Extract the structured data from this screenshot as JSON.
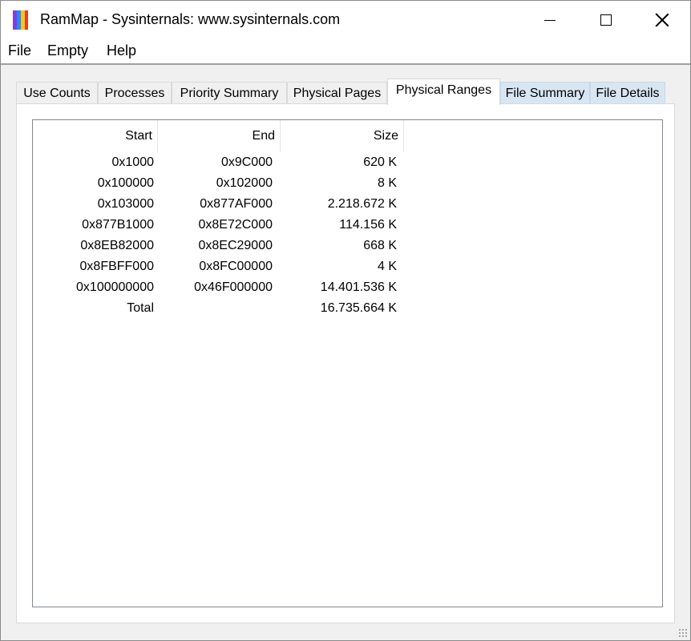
{
  "window": {
    "title": "RamMap - Sysinternals: www.sysinternals.com",
    "icon": "rammap-app-icon",
    "icon_colors": [
      "#7b3fe4",
      "#2f86f6",
      "#f5c518",
      "#e0402e"
    ],
    "controls": {
      "minimize": "minimize-icon",
      "maximize": "maximize-icon",
      "close": "close-icon"
    }
  },
  "menu": {
    "file": "File",
    "empty": "Empty",
    "help": "Help"
  },
  "tabs": [
    {
      "label": "Use Counts",
      "active": false
    },
    {
      "label": "Processes",
      "active": false
    },
    {
      "label": "Priority Summary",
      "active": false
    },
    {
      "label": "Physical Pages",
      "active": false
    },
    {
      "label": "Physical Ranges",
      "active": true
    },
    {
      "label": "File Summary",
      "active": false,
      "hover": true
    },
    {
      "label": "File Details",
      "active": false,
      "hover": true
    }
  ],
  "table": {
    "columns": {
      "start": "Start",
      "end": "End",
      "size": "Size"
    },
    "rows": [
      {
        "start": "0x1000",
        "end": "0x9C000",
        "size": "620 K"
      },
      {
        "start": "0x100000",
        "end": "0x102000",
        "size": "8 K"
      },
      {
        "start": "0x103000",
        "end": "0x877AF000",
        "size": "2.218.672 K"
      },
      {
        "start": "0x877B1000",
        "end": "0x8E72C000",
        "size": "114.156 K"
      },
      {
        "start": "0x8EB82000",
        "end": "0x8EC29000",
        "size": "668 K"
      },
      {
        "start": "0x8FBFF000",
        "end": "0x8FC00000",
        "size": "4 K"
      },
      {
        "start": "0x100000000",
        "end": "0x46F000000",
        "size": "14.401.536 K"
      },
      {
        "start": "Total",
        "end": "",
        "size": "16.735.664 K"
      }
    ]
  }
}
